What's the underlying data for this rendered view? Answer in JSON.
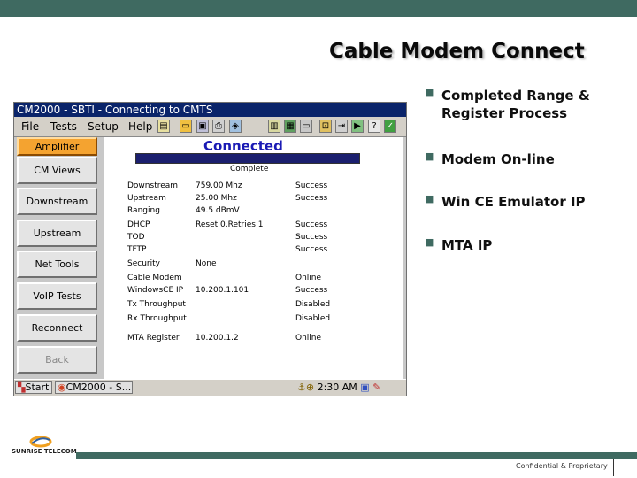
{
  "slide": {
    "title": "Cable Modem Connect",
    "bullets": [
      "Completed Range & Register Process",
      "Modem On-line",
      "Win CE Emulator IP",
      "MTA IP"
    ],
    "footer": {
      "logo_text": "SUNRISE TELECOM",
      "confidential": "Confidential & Proprietary"
    },
    "accent_color": "#3f6a61"
  },
  "window": {
    "title": "CM2000 - SBTI - Connecting to CMTS",
    "menu": [
      "File",
      "Tests",
      "Setup",
      "Help"
    ],
    "toolbar_icons": [
      "open-icon",
      "save-icon",
      "print-icon",
      "network-icon",
      "chart-icon",
      "config-icon",
      "modem-icon",
      "lock-icon",
      "export-icon",
      "play-icon",
      "info-icon",
      "exit-icon"
    ],
    "sidebar": [
      "Amplifier",
      "CM Views",
      "Downstream",
      "Upstream",
      "Net Tools",
      "VoIP Tests",
      "Reconnect",
      "Back"
    ],
    "status_heading": "Connected",
    "progress_label": "Complete",
    "rows": [
      {
        "label": "Downstream",
        "value": "759.00 Mhz",
        "status": "Success"
      },
      {
        "label": "Upstream",
        "value": "25.00 Mhz",
        "status": "Success"
      },
      {
        "label": "Ranging",
        "value": "49.5 dBmV",
        "status": ""
      },
      {
        "label": "DHCP",
        "value": "Reset 0,Retries 1",
        "status": "Success"
      },
      {
        "label": "TOD",
        "value": "",
        "status": "Success"
      },
      {
        "label": "TFTP",
        "value": "",
        "status": "Success"
      },
      {
        "label": "Security",
        "value": "None",
        "status": ""
      },
      {
        "label": "Cable Modem",
        "value": "",
        "status": "Online"
      },
      {
        "label": "WindowsCE IP",
        "value": "10.200.1.101",
        "status": "Success"
      },
      {
        "label": "Tx Throughput",
        "value": "",
        "status": "Disabled"
      },
      {
        "label": "Rx Throughput",
        "value": "",
        "status": "Disabled"
      },
      {
        "label": "MTA Register",
        "value": "10.200.1.2",
        "status": "Online"
      }
    ],
    "taskbar": {
      "start": "Start",
      "task": "CM2000 - S...",
      "clock": "2:30 AM"
    }
  }
}
